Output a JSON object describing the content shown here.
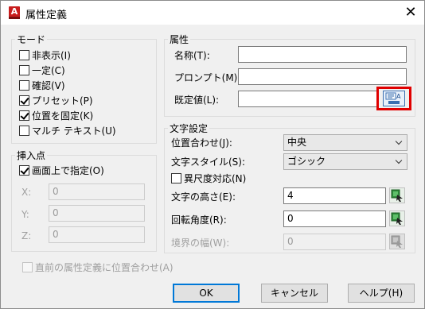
{
  "window": {
    "title": "属性定義",
    "app_icon_letter": "A",
    "close_glyph": "✕"
  },
  "mode": {
    "legend": "モード",
    "options": [
      {
        "label": "非表示(I)",
        "checked": false
      },
      {
        "label": "一定(C)",
        "checked": false
      },
      {
        "label": "確認(V)",
        "checked": false
      },
      {
        "label": "プリセット(P)",
        "checked": true
      },
      {
        "label": "位置を固定(K)",
        "checked": true
      },
      {
        "label": "マルチ テキスト(U)",
        "checked": false
      }
    ]
  },
  "attribute": {
    "legend": "属性",
    "tag_label": "名称(T):",
    "tag_value": "",
    "prompt_label": "プロンプト(M):",
    "prompt_value": "",
    "default_label": "既定値(L):",
    "default_value": "",
    "insert_field_icon": "insert-field-icon"
  },
  "insertion_point": {
    "legend": "挿入点",
    "specify_on_screen_label": "画面上で指定(O)",
    "specify_on_screen_checked": true,
    "x_label": "X:",
    "x_value": "0",
    "y_label": "Y:",
    "y_value": "0",
    "z_label": "Z:",
    "z_value": "0"
  },
  "text_settings": {
    "legend": "文字設定",
    "justification_label": "位置合わせ(J):",
    "justification_value": "中央",
    "text_style_label": "文字スタイル(S):",
    "text_style_value": "ゴシック",
    "annotative_label": "異尺度対応(N)",
    "annotative_checked": false,
    "text_height_label": "文字の高さ(E):",
    "text_height_value": "4",
    "rotation_label": "回転角度(R):",
    "rotation_value": "0",
    "boundary_width_label": "境界の幅(W):",
    "boundary_width_value": "0"
  },
  "align_below_label": "直前の属性定義に位置合わせ(A)",
  "align_below_checked": false,
  "buttons": {
    "ok": "OK",
    "cancel": "キャンセル",
    "help": "ヘルプ(H)"
  },
  "colors": {
    "highlight": "#e00000",
    "pick_icon_green": "#2e8b3a",
    "default_button_border": "#0078d7"
  }
}
